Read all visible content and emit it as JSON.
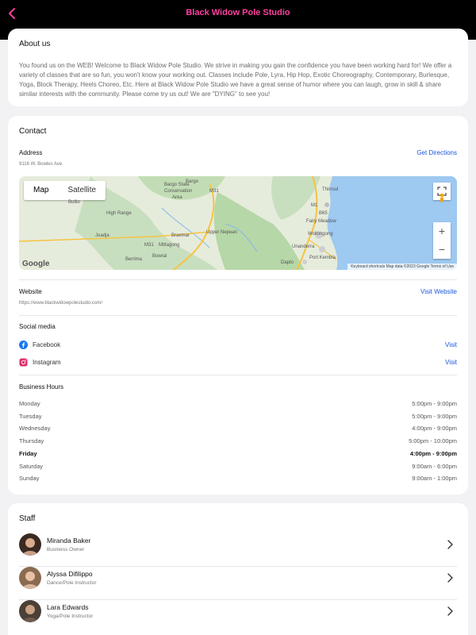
{
  "header": {
    "title": "Black Widow Pole Studio"
  },
  "about": {
    "title": "About us",
    "text": "You found us on the WEB! Welcome to Black Widow Pole Studio. We strive in making you gain the confidence you have been working hard for! We offer a variety of classes that are so fun, you won't know your working out. Classes include Pole, Lyra, Hip Hop, Exotic Choreography, Contemporary, Burlesque, Yoga, Block Therapy, Heels Choreo, Etc. Here at Black Widow Pole Studio we have a great sense of humor where you can laugh, grow in skill & share similar interests with the community. Please come try us out! We are \"DYING\" to see you!"
  },
  "contact": {
    "title": "Contact",
    "address_label": "Address",
    "address": "9116 W. Bowles Ave.",
    "directions_label": "Get Directions",
    "map": {
      "map_tab": "Map",
      "satellite_tab": "Satellite",
      "zoom_in": "+",
      "zoom_out": "−",
      "google_mark": "Google",
      "footer": "Keyboard shortcuts   Map data ©2023 Google   Terms of Use",
      "places": {
        "bargo": "Bargo",
        "bargo_state": "Bargo State",
        "conservation": "Conservation",
        "area": "Area",
        "bullio": "Bullio",
        "high_range": "High Range",
        "joadja": "Joadja",
        "braemar": "Braemar",
        "mittagong": "Mittagong",
        "bowral": "Bowral",
        "berrima": "Berrima",
        "upper_nepean": "Upper Nepean",
        "thirroul": "Thirroul",
        "fairy_meadow": "Fairy Meadow",
        "wollongong": "Wollongong",
        "unanderra": "Unanderra",
        "port_kembla": "Port Kembla",
        "dapto": "Dapto",
        "m31_a": "M31",
        "m31_b": "M31",
        "b65": "B65",
        "m1": "M1"
      }
    },
    "website_label": "Website",
    "website_url": "https://www.blackwidowpolestudio.com/",
    "visit_website_label": "Visit Website",
    "social_label": "Social media",
    "social": [
      {
        "name": "Facebook",
        "action": "Visit",
        "icon": "facebook-icon",
        "color": "#1877f2"
      },
      {
        "name": "Instagram",
        "action": "Visit",
        "icon": "instagram-icon",
        "color": "#e1306c"
      }
    ],
    "hours_label": "Business Hours",
    "hours": [
      {
        "day": "Monday",
        "time": "5:00pm - 9:00pm"
      },
      {
        "day": "Tuesday",
        "time": "5:00pm - 9:00pm"
      },
      {
        "day": "Wednesday",
        "time": "4:00pm - 9:00pm"
      },
      {
        "day": "Thursday",
        "time": "5:00pm - 10:00pm"
      },
      {
        "day": "Friday",
        "time": "4:00pm - 9:00pm"
      },
      {
        "day": "Saturday",
        "time": "9:00am - 6:00pm"
      },
      {
        "day": "Sunday",
        "time": "9:00am - 1:00pm"
      }
    ]
  },
  "staff": {
    "title": "Staff",
    "members": [
      {
        "name": "Miranda Baker",
        "role": "Business Owner"
      },
      {
        "name": "Alyssa Difilippo",
        "role": "Dance/Pole Instructor"
      },
      {
        "name": "Lara Edwards",
        "role": "Yoga/Pole Instructor"
      }
    ]
  },
  "colors": {
    "accent": "#ff3fa0",
    "link": "#1a56db"
  }
}
